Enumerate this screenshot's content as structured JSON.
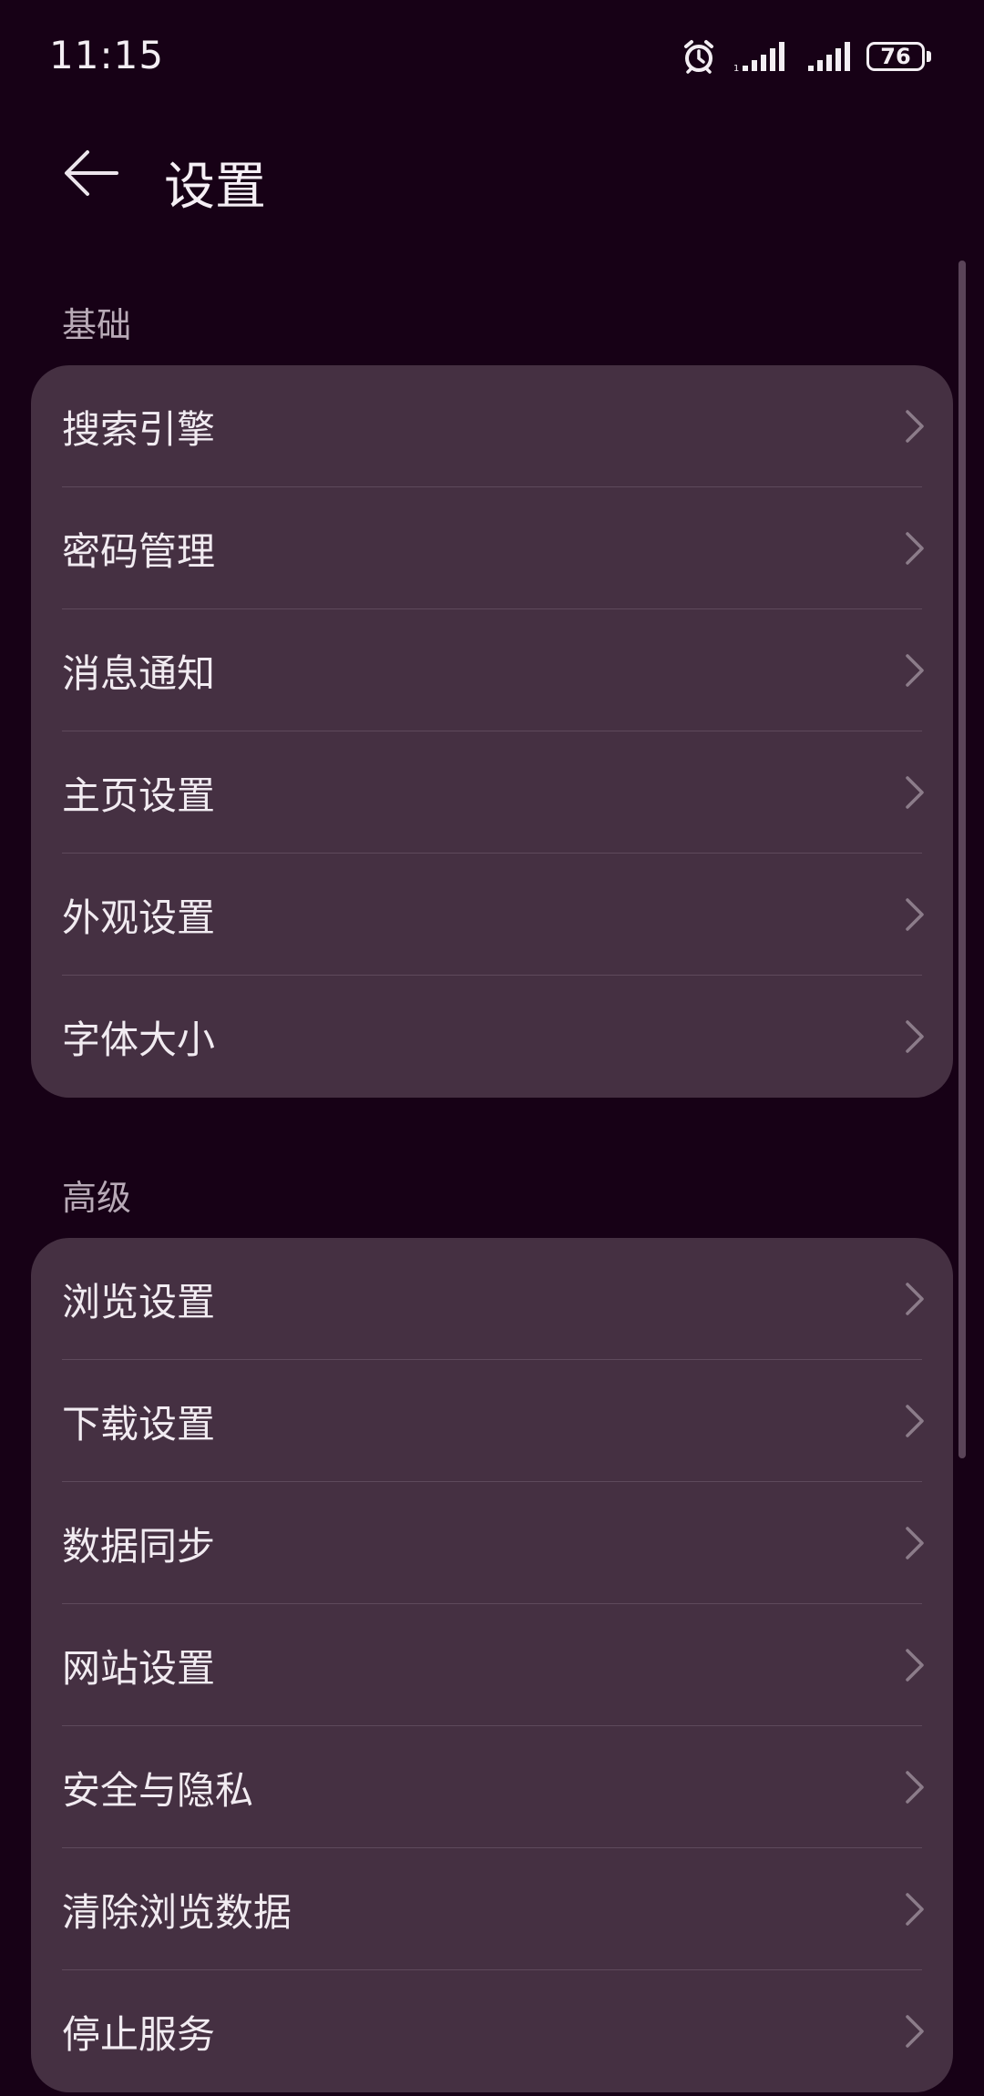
{
  "status_bar": {
    "time": "11:15",
    "battery_level": "76",
    "icons": [
      "alarm-icon",
      "signal-icon",
      "signal-icon",
      "battery-icon"
    ]
  },
  "header": {
    "title": "设置",
    "back_icon": "back-arrow-icon"
  },
  "sections": [
    {
      "title": "基础",
      "items": [
        {
          "label": "搜索引擎"
        },
        {
          "label": "密码管理"
        },
        {
          "label": "消息通知"
        },
        {
          "label": "主页设置"
        },
        {
          "label": "外观设置"
        },
        {
          "label": "字体大小"
        }
      ]
    },
    {
      "title": "高级",
      "items": [
        {
          "label": "浏览设置"
        },
        {
          "label": "下载设置"
        },
        {
          "label": "数据同步"
        },
        {
          "label": "网站设置"
        },
        {
          "label": "安全与隐私"
        },
        {
          "label": "清除浏览数据"
        },
        {
          "label": "停止服务"
        }
      ]
    }
  ],
  "colors": {
    "background": "#170116",
    "card": "#453042",
    "text": "#f1ebf1",
    "section_title": "#b8aab7",
    "chevron": "#8c7c8a"
  }
}
